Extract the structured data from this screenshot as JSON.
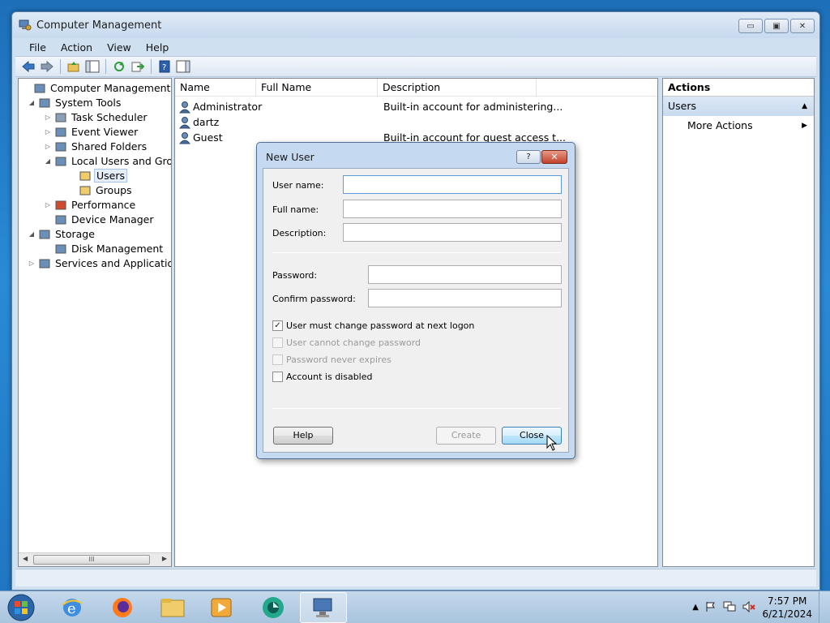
{
  "window": {
    "title": "Computer Management",
    "buttons": {
      "minimize": "▭",
      "maximize": "▣",
      "close": "✕"
    }
  },
  "menu": [
    "File",
    "Action",
    "View",
    "Help"
  ],
  "tree": [
    {
      "label": "Computer Management (Local",
      "level": 0,
      "expander": "",
      "icon": "computer-management-icon"
    },
    {
      "label": "System Tools",
      "level": 1,
      "expander": "◢",
      "icon": "system-tools-icon"
    },
    {
      "label": "Task Scheduler",
      "level": 2,
      "expander": "▷",
      "icon": "task-scheduler-icon"
    },
    {
      "label": "Event Viewer",
      "level": 2,
      "expander": "▷",
      "icon": "event-viewer-icon"
    },
    {
      "label": "Shared Folders",
      "level": 2,
      "expander": "▷",
      "icon": "shared-folders-icon"
    },
    {
      "label": "Local Users and Groups",
      "level": 2,
      "expander": "◢",
      "icon": "local-users-icon"
    },
    {
      "label": "Users",
      "level": 3,
      "expander": "",
      "icon": "folder-icon",
      "selected": true
    },
    {
      "label": "Groups",
      "level": 3,
      "expander": "",
      "icon": "folder-icon"
    },
    {
      "label": "Performance",
      "level": 2,
      "expander": "▷",
      "icon": "performance-icon"
    },
    {
      "label": "Device Manager",
      "level": 2,
      "expander": "",
      "icon": "device-manager-icon"
    },
    {
      "label": "Storage",
      "level": 1,
      "expander": "◢",
      "icon": "storage-icon"
    },
    {
      "label": "Disk Management",
      "level": 2,
      "expander": "",
      "icon": "disk-management-icon"
    },
    {
      "label": "Services and Applications",
      "level": 1,
      "expander": "▷",
      "icon": "services-icon"
    }
  ],
  "tree_scroll_label": "III",
  "list": {
    "columns": [
      "Name",
      "Full Name",
      "Description"
    ],
    "rows": [
      {
        "name": "Administrator",
        "full_name": "",
        "description": "Built-in account for administering..."
      },
      {
        "name": "dartz",
        "full_name": "",
        "description": ""
      },
      {
        "name": "Guest",
        "full_name": "",
        "description": "Built-in account for guest access t..."
      }
    ]
  },
  "actions": {
    "title": "Actions",
    "section": "Users",
    "items": [
      "More Actions"
    ]
  },
  "dialog": {
    "title": "New User",
    "help_glyph": "?",
    "close_glyph": "✕",
    "fields": {
      "user_name": {
        "label": "User name:",
        "value": ""
      },
      "full_name": {
        "label": "Full name:",
        "value": ""
      },
      "description": {
        "label": "Description:",
        "value": ""
      },
      "password": {
        "label": "Password:",
        "value": ""
      },
      "confirm_password": {
        "label": "Confirm password:",
        "value": ""
      }
    },
    "checkboxes": [
      {
        "label": "User must change password at next logon",
        "checked": true,
        "disabled": false
      },
      {
        "label": "User cannot change password",
        "checked": false,
        "disabled": true
      },
      {
        "label": "Password never expires",
        "checked": false,
        "disabled": true
      },
      {
        "label": "Account is disabled",
        "checked": false,
        "disabled": false
      }
    ],
    "buttons": {
      "help": "Help",
      "create": "Create",
      "close": "Close"
    }
  },
  "taskbar": {
    "clock_time": "7:57 PM",
    "clock_date": "6/21/2024"
  },
  "colors": {
    "accent": "#3c7fb1",
    "selection": "#e5eefb",
    "desktop": "#1f74bf"
  }
}
